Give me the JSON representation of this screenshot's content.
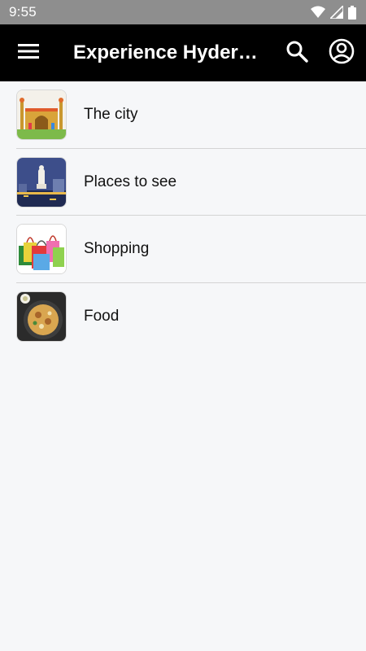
{
  "status_bar": {
    "time": "9:55"
  },
  "app_bar": {
    "title": "Experience Hyderabad"
  },
  "items": [
    {
      "label": "The city",
      "thumb_icon": "charminar-thumbnail"
    },
    {
      "label": "Places to see",
      "thumb_icon": "buddha-statue-thumbnail"
    },
    {
      "label": "Shopping",
      "thumb_icon": "shopping-bags-thumbnail"
    },
    {
      "label": "Food",
      "thumb_icon": "biryani-thumbnail"
    }
  ],
  "colors": {
    "app_bar": "#000000",
    "status_bar": "#8e8e8e",
    "background": "#f6f7f9",
    "divider": "#d4d4d4"
  }
}
